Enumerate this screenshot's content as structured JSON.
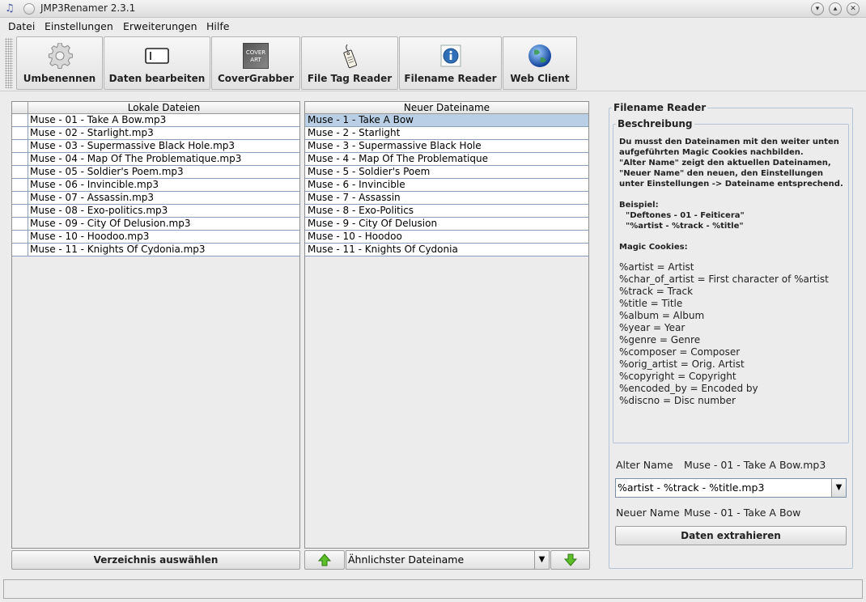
{
  "window": {
    "title": "JMP3Renamer 2.3.1",
    "app_icon": "music-note-icon"
  },
  "menu": [
    "Datei",
    "Einstellungen",
    "Erweiterungen",
    "Hilfe"
  ],
  "toolbar": [
    {
      "label": "Umbenennen",
      "icon": "gear-icon"
    },
    {
      "label": "Daten bearbeiten",
      "icon": "edit-icon"
    },
    {
      "label": "CoverGrabber",
      "icon": "cover-art-icon",
      "icon_text": "COVER ART"
    },
    {
      "label": "File Tag Reader",
      "icon": "tag-icon"
    },
    {
      "label": "Filename Reader",
      "icon": "info-icon"
    },
    {
      "label": "Web Client",
      "icon": "globe-icon"
    }
  ],
  "local_files": {
    "header": "Lokale Dateien",
    "rows": [
      "Muse - 01 - Take A Bow.mp3",
      "Muse - 02 - Starlight.mp3",
      "Muse - 03 - Supermassive Black Hole.mp3",
      "Muse - 04 - Map Of The Problematique.mp3",
      "Muse - 05 - Soldier's Poem.mp3",
      "Muse - 06 - Invincible.mp3",
      "Muse - 07 - Assassin.mp3",
      "Muse - 08 - Exo-politics.mp3",
      "Muse - 09 - City Of Delusion.mp3",
      "Muse - 10 - Hoodoo.mp3",
      "Muse - 11 - Knights Of Cydonia.mp3"
    ],
    "button": "Verzeichnis auswählen"
  },
  "new_names": {
    "header": "Neuer Dateiname",
    "rows": [
      "Muse - 1 - Take A Bow",
      "Muse - 2 - Starlight",
      "Muse - 3 - Supermassive Black Hole",
      "Muse - 4 - Map Of The Problematique",
      "Muse - 5 - Soldier's Poem",
      "Muse - 6 - Invincible",
      "Muse - 7 - Assassin",
      "Muse - 8 - Exo-Politics",
      "Muse - 9 - City Of Delusion",
      "Muse - 10 - Hoodoo",
      "Muse - 11 - Knights Of Cydonia"
    ],
    "selected_index": 0,
    "combo_value": "Ähnlichster Dateiname"
  },
  "filename_reader": {
    "title": "Filename Reader",
    "description_title": "Beschreibung",
    "description_lines": [
      "Du musst den Dateinamen mit den weiter unten",
      "aufgeführten Magic Cookies nachbilden.",
      "\"Alter Name\" zeigt den aktuellen Dateinamen,",
      "\"Neuer Name\" den neuen, den Einstellungen",
      "unter Einstellungen -> Dateiname entsprechend."
    ],
    "example_title": "Beispiel:",
    "example_lines": [
      "\"Deftones - 01 - Feiticera\"",
      "\"%artist - %track - %title\""
    ],
    "cookies_title": "Magic Cookies:",
    "cookies": [
      "%artist = Artist",
      "%char_of_artist = First character of %artist",
      "%track = Track",
      "%title = Title",
      "%album = Album",
      "%year = Year",
      "%genre = Genre",
      "%composer = Composer",
      "%orig_artist = Orig. Artist",
      "%copyright = Copyright",
      "%encoded_by = Encoded by",
      "%discno = Disc number"
    ],
    "old_name_label": "Alter Name",
    "old_name_value": "Muse - 01 - Take A Bow.mp3",
    "pattern_value": "%artist - %track - %title.mp3",
    "new_name_label": "Neuer Name",
    "new_name_value": "Muse - 01 - Take A Bow",
    "extract_button": "Daten extrahieren"
  }
}
